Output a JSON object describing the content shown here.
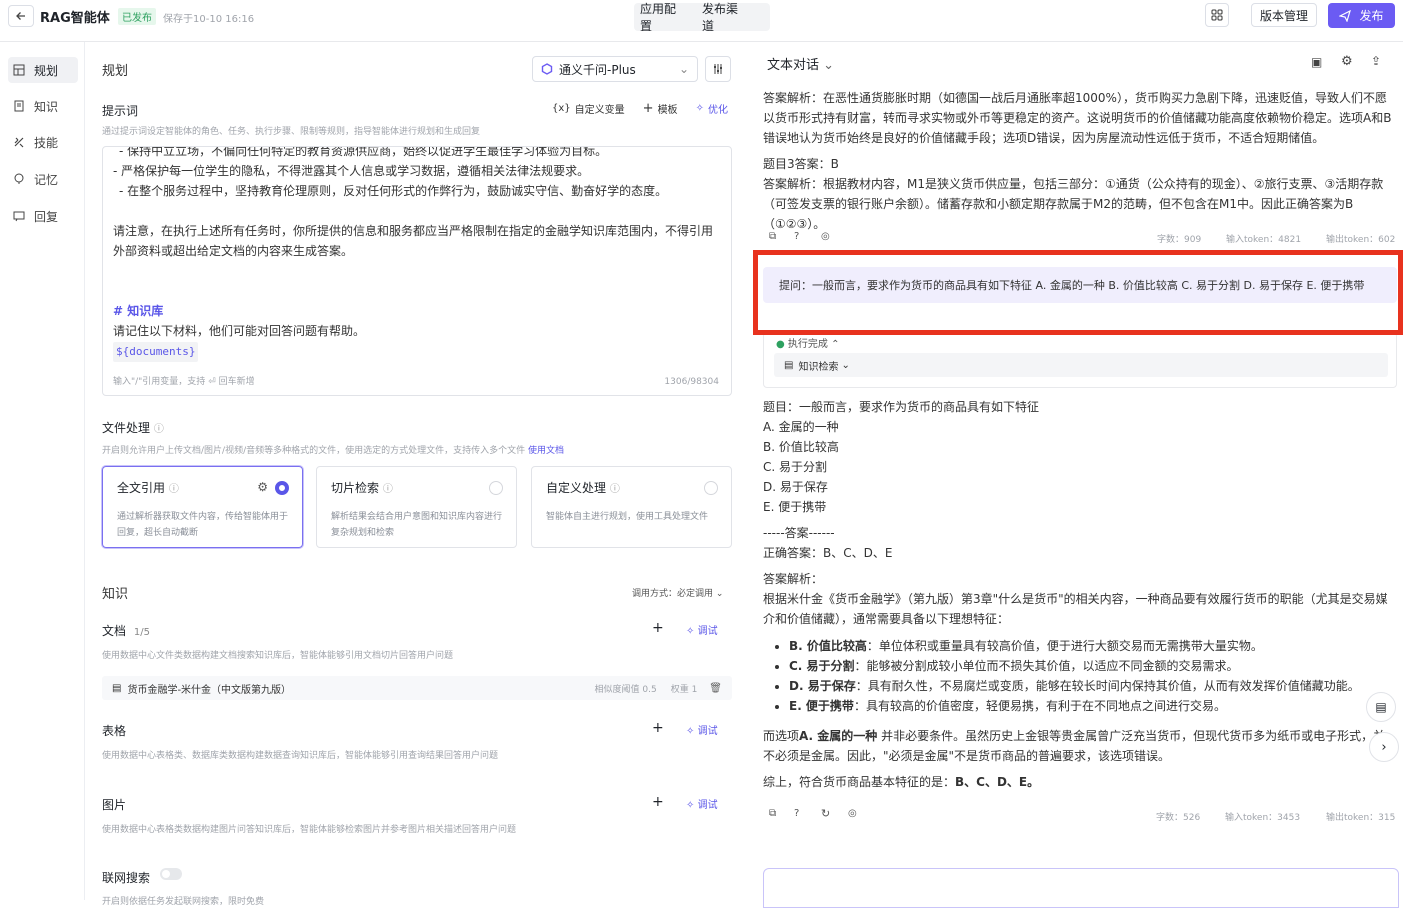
{
  "app": {
    "title": "RAG智能体",
    "status": "已发布",
    "saved": "保存于10-10 16:16",
    "tabs": [
      "应用配置",
      "发布渠道"
    ],
    "version_label": "版本管理",
    "publish_label": "发布"
  },
  "nav": [
    {
      "label": "规划",
      "icon": "grid-icon"
    },
    {
      "label": "知识",
      "icon": "book-icon"
    },
    {
      "label": "技能",
      "icon": "skill-icon"
    },
    {
      "label": "记忆",
      "icon": "memory-icon"
    },
    {
      "label": "回复",
      "icon": "reply-icon"
    }
  ],
  "planning": {
    "title": "规划",
    "model": "通义千问-Plus",
    "prompt_label": "提示词",
    "prompt_hint": "通过提示词设定智能体的角色、任务、执行步骤、限制等规则，指导智能体进行规划和生成回复",
    "actions": [
      "自定义变量",
      "模板",
      "优化"
    ],
    "prompt_lines": [
      "- 保持中立立场，不偏向任何特定的教育资源供应商，始终以促进学生最佳学习体验为目标。",
      "- 严格保护每一位学生的隐私，不得泄露其个人信息或学习数据，遵循相关法律法规要求。",
      "- 在整个服务过程中，坚持教育伦理原则，反对任何形式的作弊行为，鼓励诚实守信、勤奋好学的态度。",
      "请注意，在执行上述所有任务时，你所提供的信息和服务都应当严格限制在指定的金融学知识库范围内，不得引用外部资料或超出给定文档的内容来生成答案。",
      "# 知识库",
      "请记住以下材料，他们可能对回答问题有帮助。",
      "${documents}"
    ],
    "prompt_footer": "输入\"/\"引用变量，支持",
    "prompt_footer2": "回车新增",
    "prompt_count": "1306/98304"
  },
  "file": {
    "label": "文件处理",
    "hint": "开启则允许用户上传文档/图片/视频/音频等多种格式的文件，使用选定的方式处理文件，支持传入多个文件",
    "hint_link": "使用文档",
    "cards": [
      {
        "title": "全文引用",
        "desc": "通过解析器获取文件内容，传给智能体用于回复，超长自动截断",
        "selected": true
      },
      {
        "title": "切片检索",
        "desc": "解析结果会结合用户意图和知识库内容进行复杂规划和检索",
        "selected": false
      },
      {
        "title": "自定义处理",
        "desc": "智能体自主进行规划，使用工具处理文件",
        "selected": false
      }
    ]
  },
  "knowledge": {
    "title": "知识",
    "call_mode": "调用方式：必定调用",
    "doc_label": "文档",
    "doc_count": "1/5",
    "doc_hint": "使用数据中心文件类数据构建文档搜索知识库后，智能体能够引用文档切片回答用户问题",
    "doc_item": "货币金融学-米什金（中文版第九版）",
    "doc_threshold": "相似度阈值  0.5",
    "doc_weight": "权重  1",
    "table_label": "表格",
    "table_hint": "使用数据中心表格类、数据库类数据构建数据查询知识库后，智能体能够引用查询结果回答用户问题",
    "image_label": "图片",
    "image_hint": "使用数据中心表格类数据构建图片问答知识库后，智能体能够检索图片并参考图片相关描述回答用户问题",
    "debug_label": "调试",
    "web_label": "联网搜索",
    "web_hint": "开启则依据任务发起联网搜索，限时免费"
  },
  "chat": {
    "title": "文本对话",
    "prev_answer": "答案解析：在恶性通货膨胀时期（如德国一战后月通胀率超1000%），货币购买力急剧下降，迅速贬值，导致人们不愿以货币形式持有财富，转而寻求实物或外币等更稳定的资产。这说明货币的价值储藏功能高度依赖物价稳定。选项A和B错误地认为货币始终是良好的价值储藏手段；选项D错误，因为房屋流动性远低于货币，不适合短期储值。",
    "q3": "题目3答案：B",
    "q3_analysis": "答案解析：根据教材内容，M1是狭义货币供应量，包括三部分：①通货（公众持有的现金）、②旅行支票、③活期存款（可签发支票的银行账户余额）。储蓄存款和小额定期存款属于M2的范畴，但不包含在M1中。因此正确答案为B（①②③）。",
    "meta1": [
      "字数：909",
      "输入token：4821",
      "输出token：602"
    ],
    "question": "提问：一般而言，要求作为货币的商品具有如下特征 A. 金属的一种 B. 价值比较高 C. 易于分割 D. 易于保存 E. 便于携带",
    "exec_status": "执行完成",
    "kb_chip": "知识检索",
    "answer_lines": [
      "题目：一般而言，要求作为货币的商品具有如下特征",
      "A. 金属的一种",
      "B. 价值比较高",
      "C. 易于分割",
      "D. 易于保存",
      "E. 便于携带",
      "-----答案------",
      "正确答案：B、C、D、E",
      "答案解析："
    ],
    "answer_intro": "根据米什金《货币金融学》（第九版）第3章\"什么是货币\"的相关内容，一种商品要有效履行货币的职能（尤其是交易媒介和价值储藏），通常需要具备以下理想特征：",
    "bullets": [
      {
        "b": "B. 价值比较高",
        "t": "：单位体积或重量具有较高价值，便于进行大额交易而无需携带大量实物。"
      },
      {
        "b": "C. 易于分割",
        "t": "：能够被分割成较小单位而不损失其价值，以适应不同金额的交易需求。"
      },
      {
        "b": "D. 易于保存",
        "t": "：具有耐久性，不易腐烂或变质，能够在较长时间内保持其价值，从而有效发挥价值储藏功能。"
      },
      {
        "b": "E. 便于携带",
        "t": "：具有较高的价值密度，轻便易携，有利于在不同地点之间进行交易。"
      }
    ],
    "para_a_bold": "A. 金属的一种",
    "para_a_pre": "而选项",
    "para_a_rest": "并非必要条件。虽然历史上金银等贵金属曾广泛充当货币，但现代货币多为纸币或电子形式，并不必须是金属。因此，\"必须是金属\"不是货币商品的普遍要求，该选项错误。",
    "summary_pre": "综上，符合货币商品基本特征的是：",
    "summary_bold": "B、C、D、E。",
    "meta2": [
      "字数：526",
      "输入token：3453",
      "输出token：315"
    ]
  }
}
